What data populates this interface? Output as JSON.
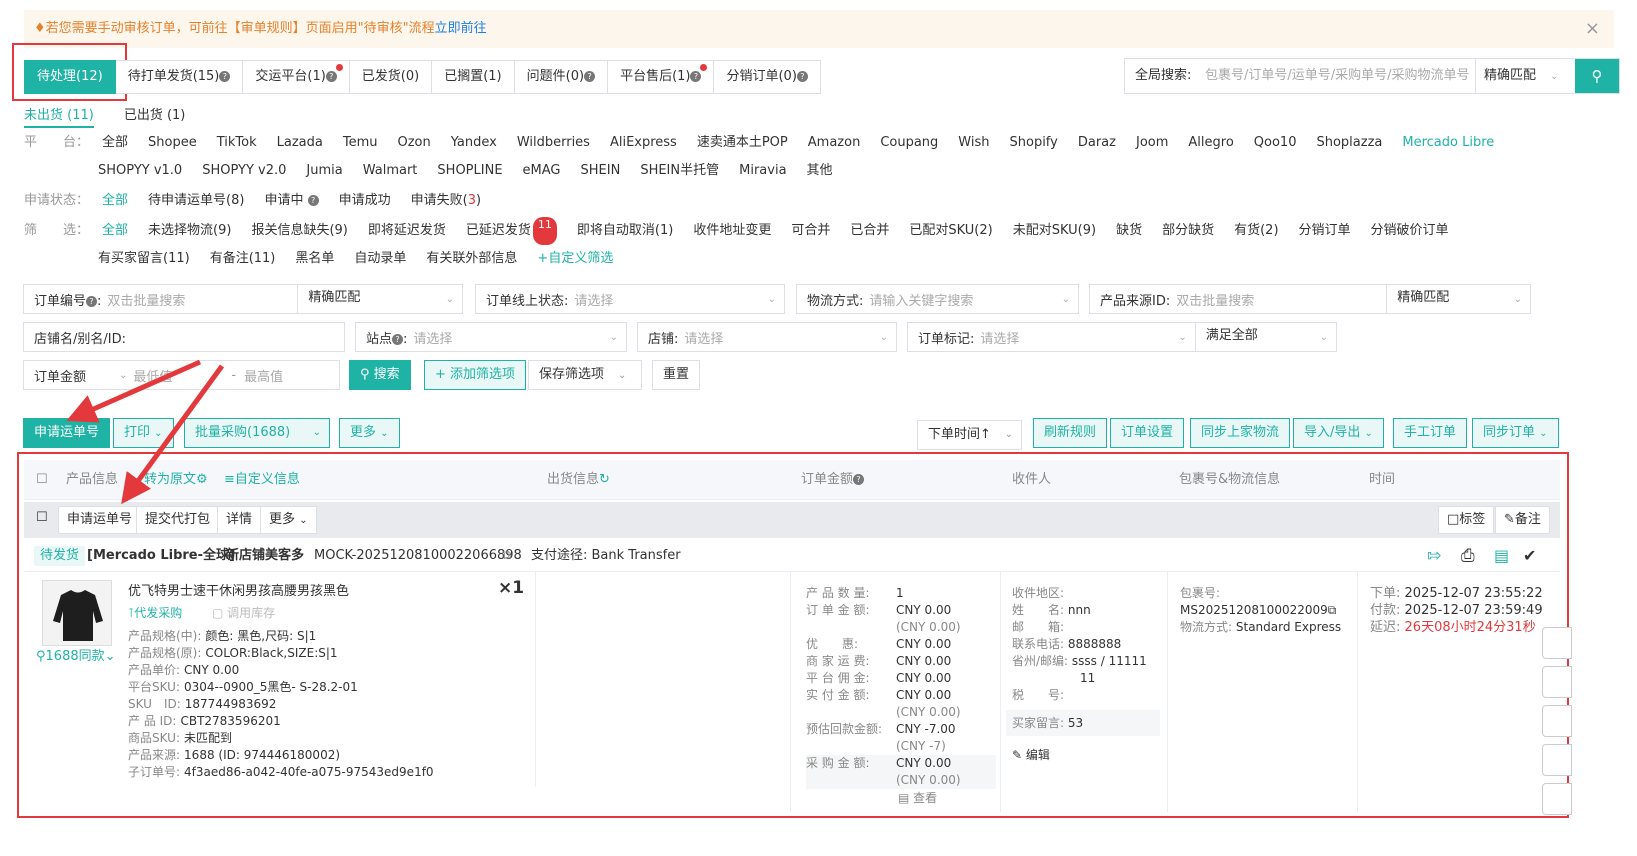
{
  "notice": {
    "text": "若您需要手动审核订单，可前往【审单规则】页面启用\"待审核\"流程",
    "link": "立即前往"
  },
  "tabs": [
    {
      "label": "待处理(12)",
      "active": true,
      "q": false,
      "dot": false
    },
    {
      "label": "待打单发货(15)",
      "q": true,
      "dot": false
    },
    {
      "label": "交运平台(1)",
      "q": true,
      "dot": true
    },
    {
      "label": "已发货(0)",
      "q": false,
      "dot": false
    },
    {
      "label": "已搁置(1)",
      "q": false,
      "dot": false
    },
    {
      "label": "问题件(0)",
      "q": true,
      "dot": false
    },
    {
      "label": "平台售后(1)",
      "q": true,
      "dot": true
    },
    {
      "label": "分销订单(0)",
      "q": true,
      "dot": false
    }
  ],
  "global_search": {
    "label": "全局搜索:",
    "placeholder": "包裹号/订单号/运单号/采购单号/采购物流单号",
    "match": "精确匹配"
  },
  "ship_tabs": [
    "未出货 (11)",
    "已出货 (1)"
  ],
  "platform": {
    "label": "平　　台：",
    "items": [
      "全部",
      "Shopee",
      "TikTok",
      "Lazada",
      "Temu",
      "Ozon",
      "Yandex",
      "Wildberries",
      "AliExpress",
      "速卖通本土POP",
      "Amazon",
      "Coupang",
      "Wish",
      "Shopify",
      "Daraz",
      "Joom",
      "Allegro",
      "Qoo10",
      "Shoplazza",
      "Mercado Libre"
    ],
    "items2": [
      "SHOPYY v1.0",
      "SHOPYY v2.0",
      "Jumia",
      "Walmart",
      "SHOPLINE",
      "eMAG",
      "SHEIN",
      "SHEIN半托管",
      "Miravia",
      "其他"
    ],
    "selected": "Mercado Libre"
  },
  "apply_status": {
    "label": "申请状态：",
    "items": [
      "全部",
      "待申请运单号(8)",
      "申请中",
      "申请成功",
      "申请失败("
    ],
    "fail_num": "3",
    "fail_close": ")"
  },
  "filter": {
    "label": "筛　　选：",
    "items": [
      "全部",
      "未选择物流(9)",
      "报关信息缺失(9)",
      "即将延迟发货",
      "已延迟发货"
    ],
    "delay_badge": "11",
    "items_b": [
      "即将自动取消(1)",
      "收件地址变更",
      "可合并",
      "已合并",
      "已配对SKU(2)",
      "未配对SKU(9)",
      "缺货",
      "部分缺货",
      "有货(2)",
      "分销订单",
      "分销破价订单"
    ],
    "items2": [
      "有买家留言(11)",
      "有备注(11)",
      "黑名单",
      "自动录单",
      "有关联外部信息"
    ],
    "custom": "+自定义筛选"
  },
  "form": {
    "order_no": {
      "label": "订单编号",
      "ph": "双击批量搜索",
      "match": "精确匹配"
    },
    "online_status": {
      "label": "订单线上状态:",
      "ph": "请选择"
    },
    "logistics": {
      "label": "物流方式:",
      "ph": "请输入关键字搜索"
    },
    "source_id": {
      "label": "产品来源ID:",
      "ph": "双击批量搜索",
      "match": "精确匹配"
    },
    "shop_name": {
      "label": "店铺名/别名/ID:"
    },
    "site": {
      "label": "站点",
      "ph": "请选择"
    },
    "shop": {
      "label": "店铺:",
      "ph": "请选择"
    },
    "mark": {
      "label": "订单标记:",
      "ph": "请选择",
      "cond": "满足全部"
    },
    "amount": {
      "label": "订单金额",
      "min": "最低值",
      "dash": "-",
      "max": "最高值"
    },
    "search": "搜索",
    "add_filter": "+ 添加筛选项",
    "save_filter": "保存筛选项",
    "reset": "重置"
  },
  "toolbar": {
    "apply": "申请运单号",
    "print": "打印",
    "batch": "批量采购(1688)",
    "more": "更多",
    "sort": "下单时间",
    "refresh_rule": "刷新规则",
    "order_settings": "订单设置",
    "sync_logistics": "同步上家物流",
    "import_export": "导入/导出",
    "manual": "手工订单",
    "sync_orders": "同步订单"
  },
  "thead": {
    "product": "产品信息",
    "restore": "转为原文",
    "custom": "自定义信息",
    "ship_info": "出货信息",
    "amount": "订单金额",
    "receiver": "收件人",
    "package": "包裹号&物流信息",
    "time": "时间"
  },
  "subbar": {
    "apply": "申请运单号",
    "submit": "提交代打包",
    "detail": "详情",
    "more": "更多",
    "tag": "标签",
    "remark": "备注"
  },
  "order": {
    "status": "待发货",
    "store": "[Mercado Libre-全球]",
    "shop": "新店铺美客多",
    "id": "MOCK-20251208100022066898",
    "pay": "支付途径: Bank Transfer",
    "product": {
      "title": "优飞特男士速干休闲男孩高腰男孩黑色",
      "qty": "×1",
      "buy": "代发采购",
      "stock": "调用库存",
      "same": "1688同款",
      "lines": [
        [
          "产品规格(中):",
          "颜色: 黑色,尺码: S|1"
        ],
        [
          "产品规格(原):",
          "COLOR:Black,SIZE:S|1"
        ],
        [
          "产品单价:",
          "CNY 0.00"
        ],
        [
          "平台SKU:",
          "0304--0900_5黑色- S-28.2-01"
        ],
        [
          "SKU　ID:",
          "187744983692"
        ],
        [
          "产 品 ID:",
          "CBT2783596201"
        ],
        [
          "商品SKU:",
          "未匹配到"
        ],
        [
          "产品来源:",
          "1688 (ID: 974446180002)"
        ],
        [
          "子订单号:",
          "4f3aed86-a042-40fe-a075-97543ed9e1f0"
        ]
      ]
    },
    "amounts": [
      [
        "产 品 数 量:",
        "1",
        ""
      ],
      [
        "订 单 金 额:",
        "CNY 0.00",
        "(CNY 0.00)"
      ],
      [
        "优　　惠:",
        "CNY 0.00",
        ""
      ],
      [
        "商 家 运 费:",
        "CNY 0.00",
        ""
      ],
      [
        "平 台 佣 金:",
        "CNY 0.00",
        ""
      ],
      [
        "实 付 金 额:",
        "CNY 0.00",
        "(CNY 0.00)"
      ],
      [
        "预估回款金额:",
        "CNY -7.00",
        "(CNY -7)"
      ],
      [
        "采 购 金 额:",
        "CNY 0.00",
        "(CNY 0.00)"
      ]
    ],
    "view": "查看",
    "receiver": {
      "region": "收件地区:",
      "name_k": "姓　　名:",
      "name": "nnn",
      "mail_k": "邮　　箱:",
      "phone_k": "联系电话:",
      "phone": "8888888",
      "prov_k": "省州/邮编:",
      "prov": "ssss / 11111",
      "prov2": "11",
      "tax_k": "税　　号:",
      "msg_k": "买家留言:",
      "msg": "53",
      "edit": "编辑"
    },
    "package": {
      "k": "包裹号:",
      "no": "MS20251208100022009",
      "ship_k": "物流方式:",
      "ship": "Standard Express"
    },
    "time": {
      "order_k": "下单:",
      "order": "2025-12-07 23:55:22",
      "pay_k": "付款:",
      "pay": "2025-12-07 23:59:49",
      "delay_k": "延迟:",
      "delay": "26天08小时24分31秒"
    }
  },
  "colors": {
    "accent": "#1fb3a5",
    "warn": "#e4393c",
    "notice": "#e6812b"
  }
}
